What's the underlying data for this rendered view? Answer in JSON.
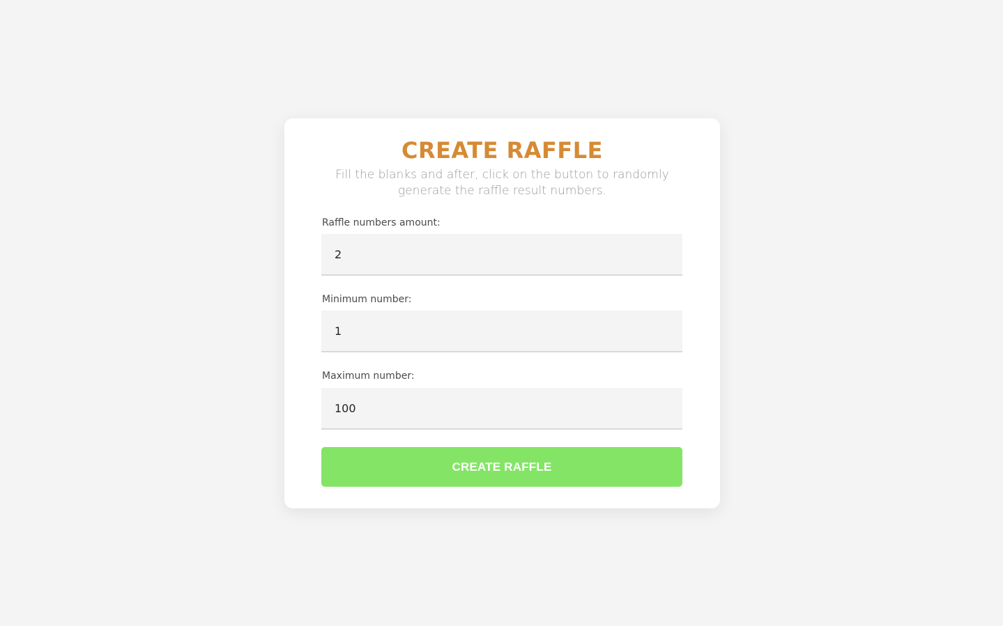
{
  "form": {
    "title": "CREATE RAFFLE",
    "subtitle": "Fill the blanks and after, click on the button to randomly generate the raffle result numbers.",
    "fields": [
      {
        "label": "Raffle numbers amount:",
        "value": "2"
      },
      {
        "label": "Minimum number:",
        "value": "1"
      },
      {
        "label": "Maximum number:",
        "value": "100"
      }
    ],
    "submit_label": "CREATE RAFFLE"
  },
  "colors": {
    "page_background": "#f4f4f4",
    "card_background": "#ffffff",
    "title": "#d68a34",
    "subtitle": "#9a9a9a",
    "button": "#84e466",
    "button_text": "#ffffff"
  }
}
